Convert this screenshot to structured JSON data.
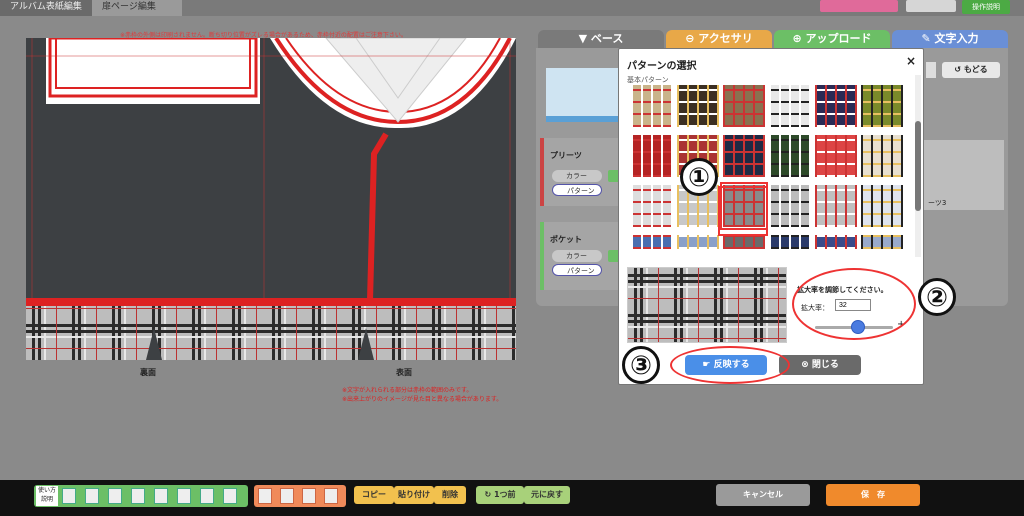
{
  "top": {
    "tab1": "アルバム表紙編集",
    "tab2": "扉ページ編集",
    "help_label": "操作説明"
  },
  "canvas": {
    "warning_top": "※赤枠の外側は印刷されません。断ち切り位置がズレる場合があるため、赤枠付近の配置はご注意下さい。",
    "back_label": "裏面",
    "front_label": "表面",
    "note_1": "※文字が入れられる部分は赤枠の範囲のみです。",
    "note_2": "※出来上がりのイメージが見た目と異なる場合があります。"
  },
  "right_panel": {
    "tabs": [
      "ベース",
      "アクセサリ",
      "アップロード",
      "文字入力"
    ],
    "undo_label": "もどる",
    "sections": [
      {
        "title": "プリーツ",
        "options": [
          "カラー",
          "パターン"
        ]
      },
      {
        "title": "ポケット",
        "options": [
          "カラー",
          "パターン"
        ]
      }
    ],
    "side_label": "ーツ3"
  },
  "modal": {
    "title": "パターンの選択",
    "close": "×",
    "category": "基本パターン",
    "zoom_instruction": "拡大率を調節してください。",
    "zoom_label": "拡大率：",
    "zoom_value": "32",
    "zoom_minus": "-",
    "zoom_plus": "+",
    "zoom_slider_fraction": 0.55,
    "apply_button": "反映する",
    "close_button": "閉じる"
  },
  "annotations": [
    "①",
    "②",
    "③"
  ],
  "toolbar": {
    "help": "使い方説明",
    "copy": "コピー",
    "paste": "貼り付け",
    "delete": "削除",
    "back_one": "1つ前",
    "restore": "元に戻す",
    "cancel": "キャンセル",
    "save": "保　存"
  },
  "colors": {
    "apply_button": "#4a8fe8",
    "save_button": "#f08a2c",
    "annotation_ring": "#e33333"
  }
}
